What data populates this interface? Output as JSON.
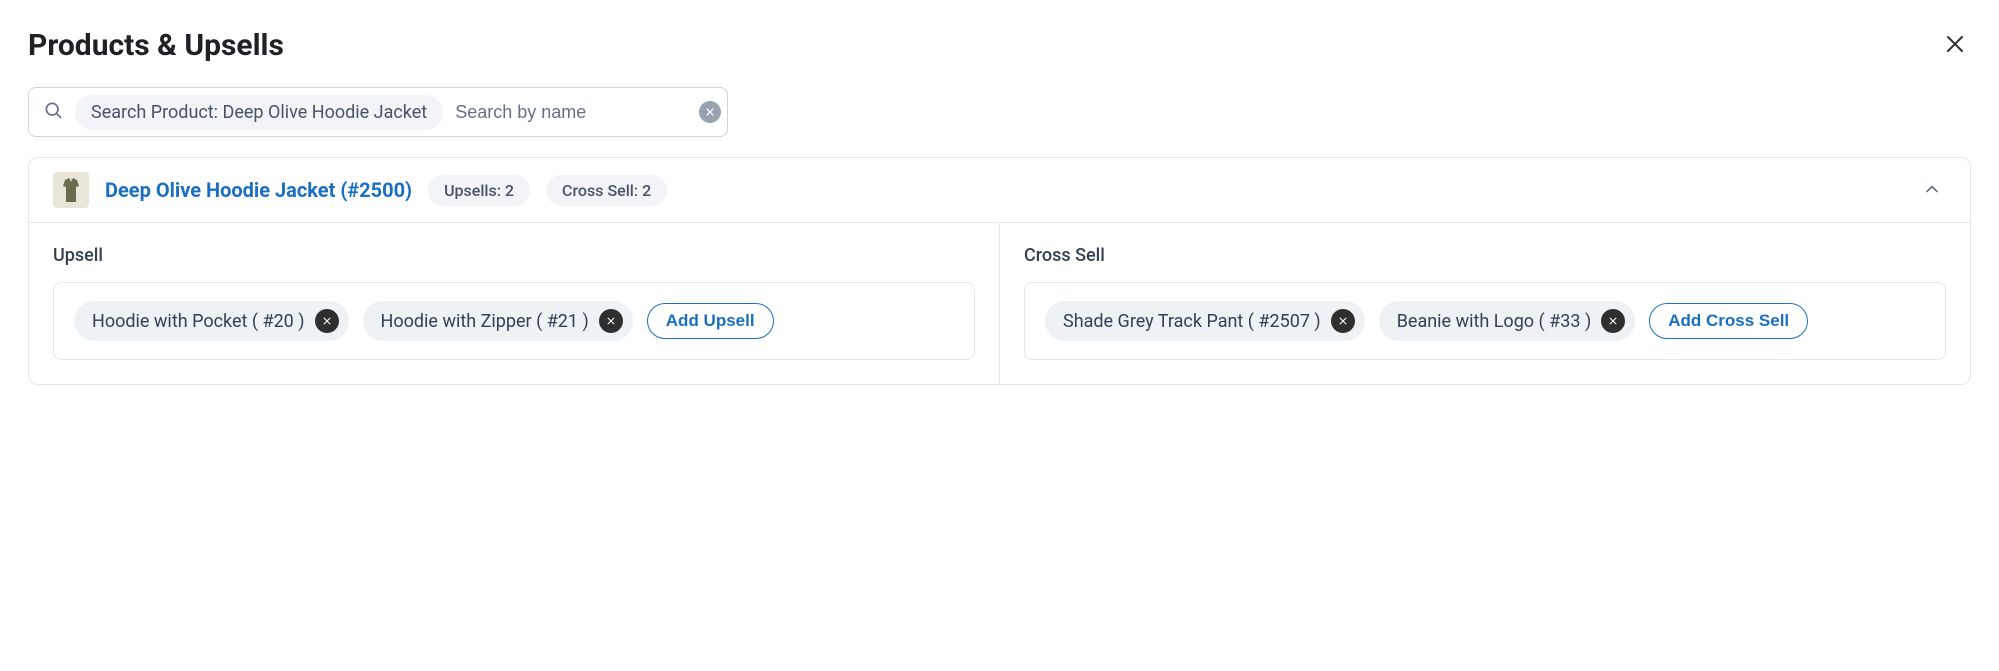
{
  "header": {
    "title": "Products & Upsells"
  },
  "search": {
    "chip_label": "Search Product: Deep Olive Hoodie Jacket",
    "placeholder": "Search by name"
  },
  "product": {
    "name": "Deep Olive Hoodie Jacket (#2500)",
    "upsells_badge": "Upsells: 2",
    "crosssell_badge": "Cross Sell: 2"
  },
  "upsell": {
    "title": "Upsell",
    "items": [
      {
        "label": "Hoodie with Pocket ( #20 )"
      },
      {
        "label": "Hoodie with Zipper ( #21 )"
      }
    ],
    "add_label": "Add Upsell"
  },
  "crosssell": {
    "title": "Cross Sell",
    "items": [
      {
        "label": "Shade Grey Track Pant ( #2507 )"
      },
      {
        "label": "Beanie with Logo ( #33 )"
      }
    ],
    "add_label": "Add Cross Sell"
  }
}
